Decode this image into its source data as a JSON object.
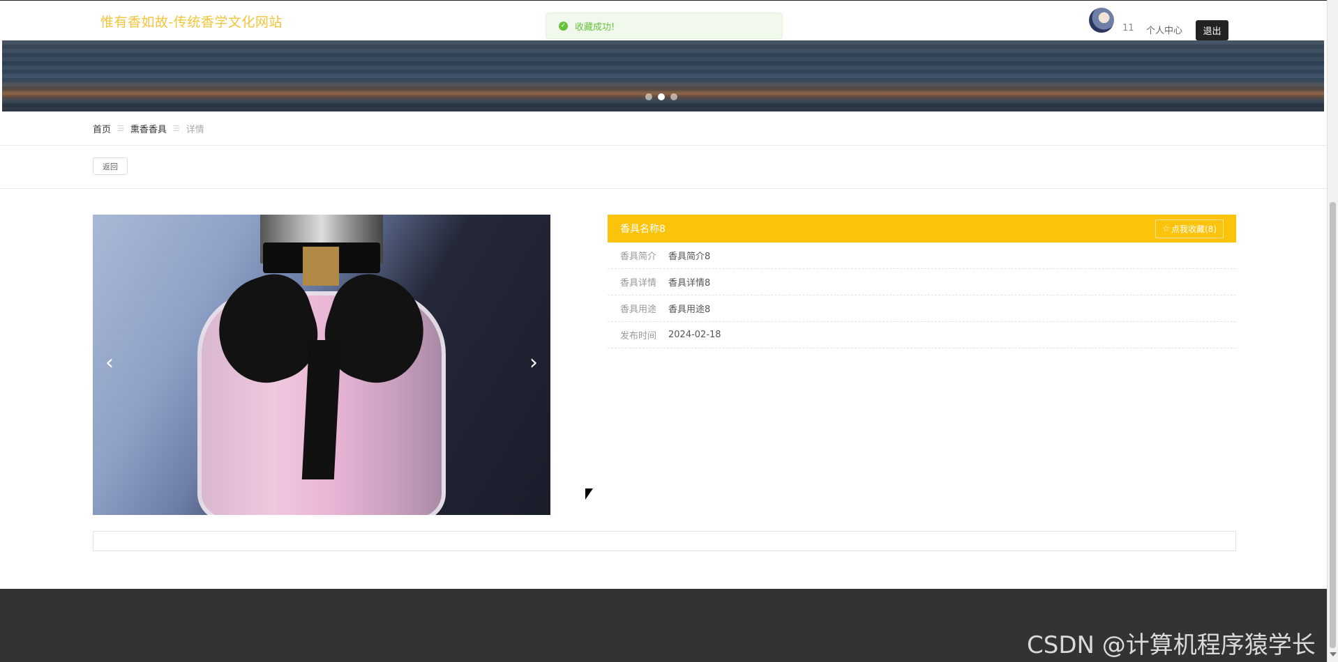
{
  "header": {
    "site_title": "惟有香如故-传统香学文化网站",
    "username": "11",
    "user_center": "个人中心",
    "logout": "退出"
  },
  "toast": {
    "message": "收藏成功!"
  },
  "banner": {
    "slide_count": 3,
    "active_slide": 2
  },
  "breadcrumb": {
    "items": [
      "首页",
      "熏香香具",
      "详情"
    ],
    "separator": "☰"
  },
  "back_label": "返回",
  "product": {
    "name": "香具名称8",
    "favorite_label": "点我收藏(8)",
    "fields": [
      {
        "label": "香具简介",
        "value": "香具简介8"
      },
      {
        "label": "香具详情",
        "value": "香具详情8"
      },
      {
        "label": "香具用途",
        "value": "香具用途8"
      },
      {
        "label": "发布时间",
        "value": "2024-02-18"
      }
    ]
  },
  "watermark": "CSDN @计算机程序猿学长",
  "colors": {
    "accent": "#fcc30c",
    "title": "#f2c53b",
    "success": "#67c23a",
    "footer": "#333333"
  },
  "icons": {
    "prev": "chevron-left-icon",
    "next": "chevron-right-icon",
    "favorite": "star-outline-icon",
    "toast": "check-circle-icon"
  }
}
